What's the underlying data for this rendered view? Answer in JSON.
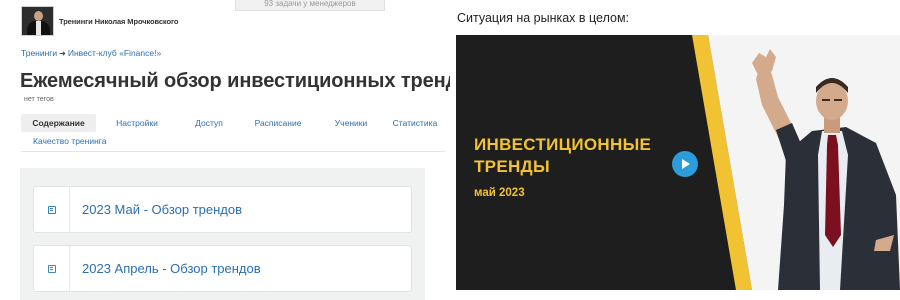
{
  "header": {
    "top_tab": "93 задачи у менеджеров",
    "brand_name": "Тренинги Николая Мрочковского"
  },
  "breadcrumb": {
    "items": [
      "Тренинги",
      "Инвест-клуб «Finance!»"
    ],
    "separator": "➜"
  },
  "page": {
    "title": "Ежемесячный обзор инвестиционных трендов",
    "tags_label": "нет тегов"
  },
  "tabs": [
    {
      "label": "Содержание",
      "active": true
    },
    {
      "label": "Настройки",
      "active": false
    },
    {
      "label": "Доступ",
      "active": false
    },
    {
      "label": "Расписание",
      "active": false
    },
    {
      "label": "Ученики",
      "active": false
    },
    {
      "label": "Статистика",
      "active": false
    },
    {
      "label": "Качество тренинга",
      "active": false
    }
  ],
  "lessons": [
    {
      "title": "2023 Май - Обзор трендов",
      "icon": "lesson-icon"
    },
    {
      "title": "2023 Апрель - Обзор трендов",
      "icon": "lesson-icon"
    }
  ],
  "right_panel": {
    "heading": "Ситуация на рынках в целом:",
    "video": {
      "title_line1": "ИНВЕСТИЦИОННЫЕ",
      "title_line2": "ТРЕНДЫ",
      "subtitle": "май 2023",
      "play_icon": "play-icon"
    }
  },
  "colors": {
    "link": "#2a6fb0",
    "video_bg": "#1e1e1e",
    "video_accent": "#f1c232",
    "play": "#2d9cdb"
  }
}
